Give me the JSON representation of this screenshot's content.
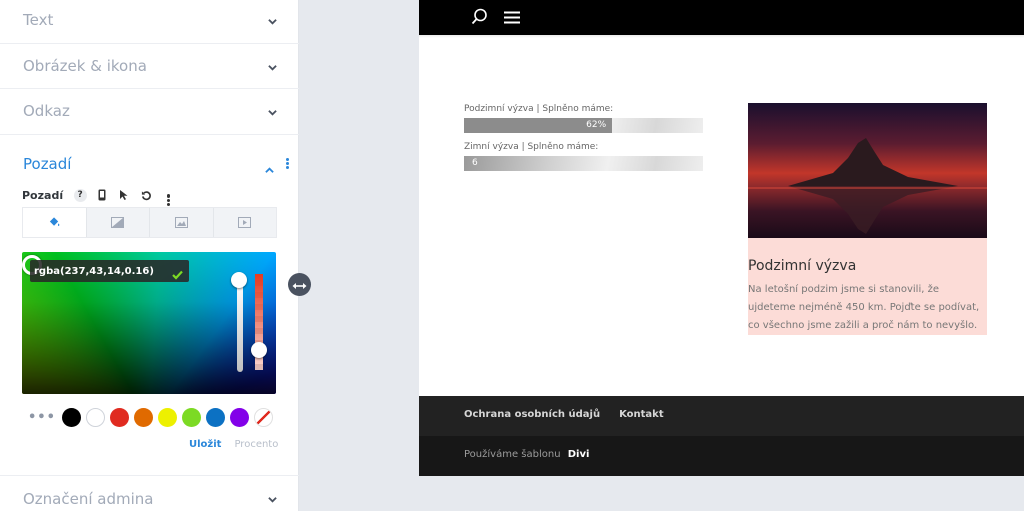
{
  "panel": {
    "sections": {
      "text": "Text",
      "image_icon": "Obrázek & ikona",
      "link": "Odkaz",
      "background": "Pozadí",
      "admin_label": "Označení admina"
    },
    "background": {
      "label": "Pozadí",
      "help": "?",
      "tabs": [
        "color-fill-icon",
        "gradient-icon",
        "image-icon",
        "video-icon"
      ],
      "color_value": "rgba(237,43,14,0.16)",
      "swatch_more": "•••",
      "swatches": [
        "#000000",
        "#ffffff",
        "#e02b20",
        "#e09900",
        "#edf000",
        "#7cda24",
        "#0c71c3",
        "#8300e9"
      ],
      "save_label": "Uložit",
      "percent_label": "Procento",
      "accent_color": "#2b87da"
    }
  },
  "preview": {
    "bars": [
      {
        "label": "Podzimní výzva | Splněno máme:",
        "percent": 62,
        "percent_text": "62%"
      },
      {
        "label": "Zimní výzva | Splněno máme:",
        "percent": 3,
        "percent_text": "6"
      }
    ],
    "card": {
      "title": "Podzimní výzva",
      "text": "Na letošní podzim jsme si stanovili, že ujdeteme nejméně 450 km. Pojďte se podívat, co všechno jsme zažili a proč nám to nevyšlo.",
      "background": "#fcdcd7"
    },
    "footer": {
      "links": [
        "Ochrana osobních údajů",
        "Kontakt"
      ],
      "credit_prefix": "Používáme šablonu",
      "credit_brand": "Divi"
    }
  }
}
